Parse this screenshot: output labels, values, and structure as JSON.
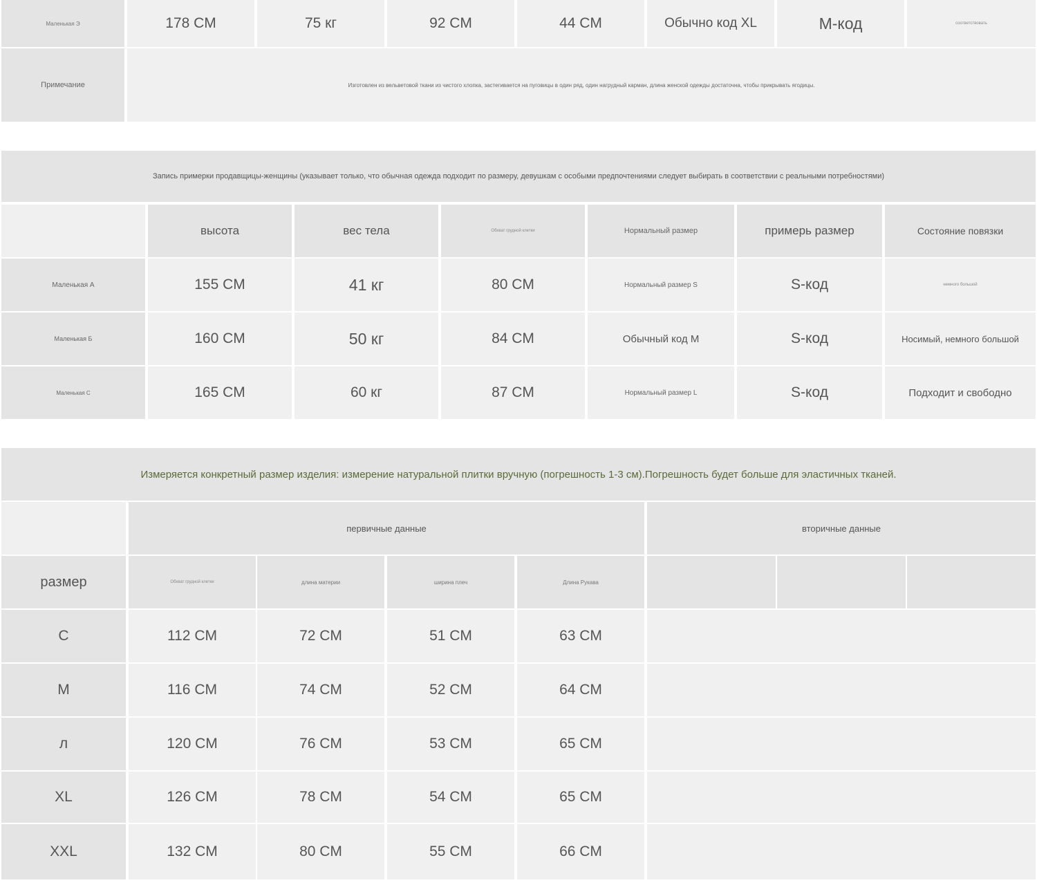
{
  "top_table": {
    "row": [
      "Маленькая Э",
      "178 CM",
      "75 кг",
      "92 CM",
      "44 CM",
      "Обычно код XL",
      "M-код",
      "соответствовать"
    ],
    "note_label": "Примечание",
    "note_text": "Изготовлен из вельветовой ткани из чистого хлопка, застегивается на пуговицы в один ряд, один нагрудный карман, длина женской одежды достаточна, чтобы прикрывать ягодицы."
  },
  "fitting": {
    "banner": "Запись примерки продавщицы-женщины (указывает только, что обычная одежда подходит по размеру, девушкам с особыми предпочтениями следует выбирать в соответствии с реальными потребностями)",
    "headers": [
      "высота",
      "вес тела",
      "Обхват грудной клетки",
      "Нормальный размер",
      "примерь размер",
      "Состояние повязки"
    ],
    "rows": [
      [
        "Маленькая А",
        "155 CM",
        "41 кг",
        "80 CM",
        "Нормальный размер S",
        "S-код",
        "немного большой"
      ],
      [
        "Маленькая Б",
        "160 CM",
        "50 кг",
        "84 CM",
        "Обычный код M",
        "S-код",
        "Носимый, немного большой"
      ],
      [
        "Маленькая С",
        "165 CM",
        "60 кг",
        "87 CM",
        "Нормальный размер L",
        "S-код",
        "Подходит и свободно"
      ]
    ]
  },
  "measure": {
    "banner": "Измеряется конкретный размер изделия: измерение натуральной плитки вручную (погрешность 1-3 см).Погрешность будет больше для эластичных тканей.",
    "group_primary": "первичные данные",
    "group_secondary": "вторичные данные",
    "size_label": "размер",
    "sub_headers": [
      "Обхват грудной клетки",
      "длина материи",
      "ширина плеч",
      "Длина Рукава"
    ],
    "rows": [
      [
        "С",
        "112 CM",
        "72 CM",
        "51 CM",
        "63 CM"
      ],
      [
        "M",
        "116 CM",
        "74 CM",
        "52 CM",
        "64 CM"
      ],
      [
        "л",
        "120 CM",
        "76 CM",
        "53 CM",
        "65 CM"
      ],
      [
        "XL",
        "126 CM",
        "78 CM",
        "54 CM",
        "65 CM"
      ],
      [
        "XXL",
        "132 CM",
        "80 CM",
        "55 CM",
        "66 CM"
      ]
    ]
  }
}
